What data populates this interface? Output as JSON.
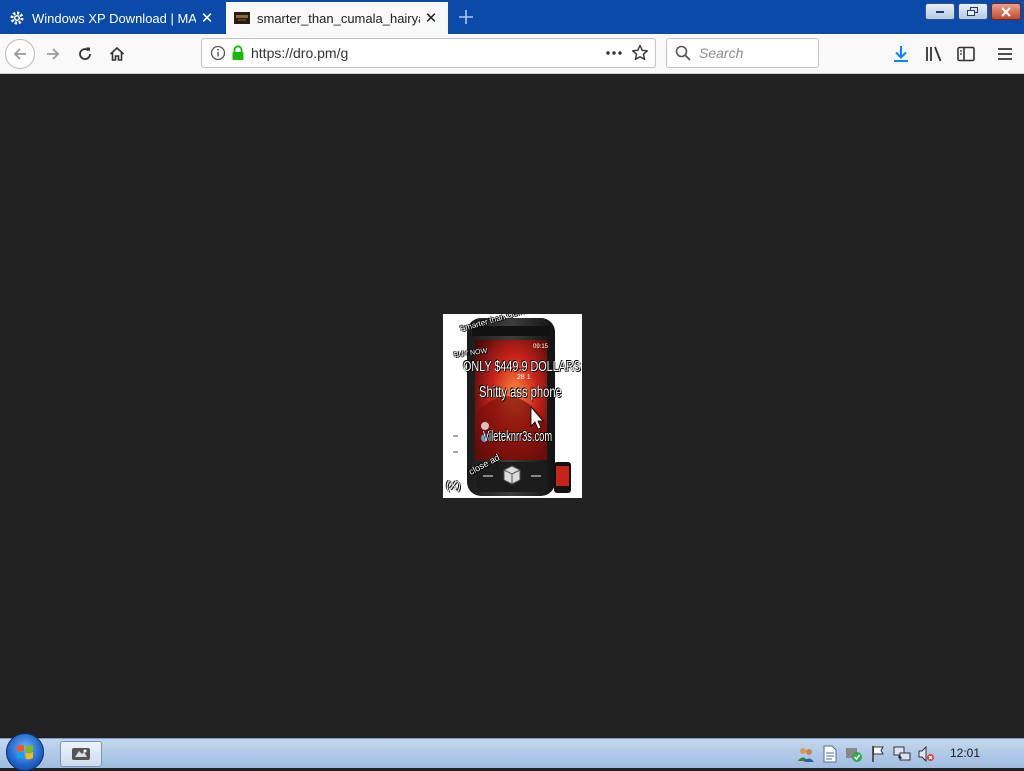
{
  "tabs": [
    {
      "title": "Windows XP Download | MAS",
      "active": false,
      "icon": "gear-icon"
    },
    {
      "title": "smarter_than_cumala_hairyass",
      "active": true,
      "icon": "page-favicon"
    }
  ],
  "toolbar": {
    "url": "https://dro.pm/g",
    "search_placeholder": "Search"
  },
  "ad": {
    "top_caption": "Smarter than Cumala Hairy ass",
    "buy_now": "BUY NOW",
    "price_line": "ONLY $449.9 DOLLARS",
    "product_line": "Shitty ass phone",
    "site_line": "Vileteknrr3s.com",
    "close_label": "close ad",
    "close_button": "(X)",
    "phone_time": "28 1",
    "phone_clock": "09:15"
  },
  "taskbar": {
    "clock": "12:01"
  },
  "colors": {
    "tabstrip": "#0b4aa8",
    "content_bg": "#222222",
    "lock_green": "#12bc00",
    "download_blue": "#0a84ff"
  }
}
